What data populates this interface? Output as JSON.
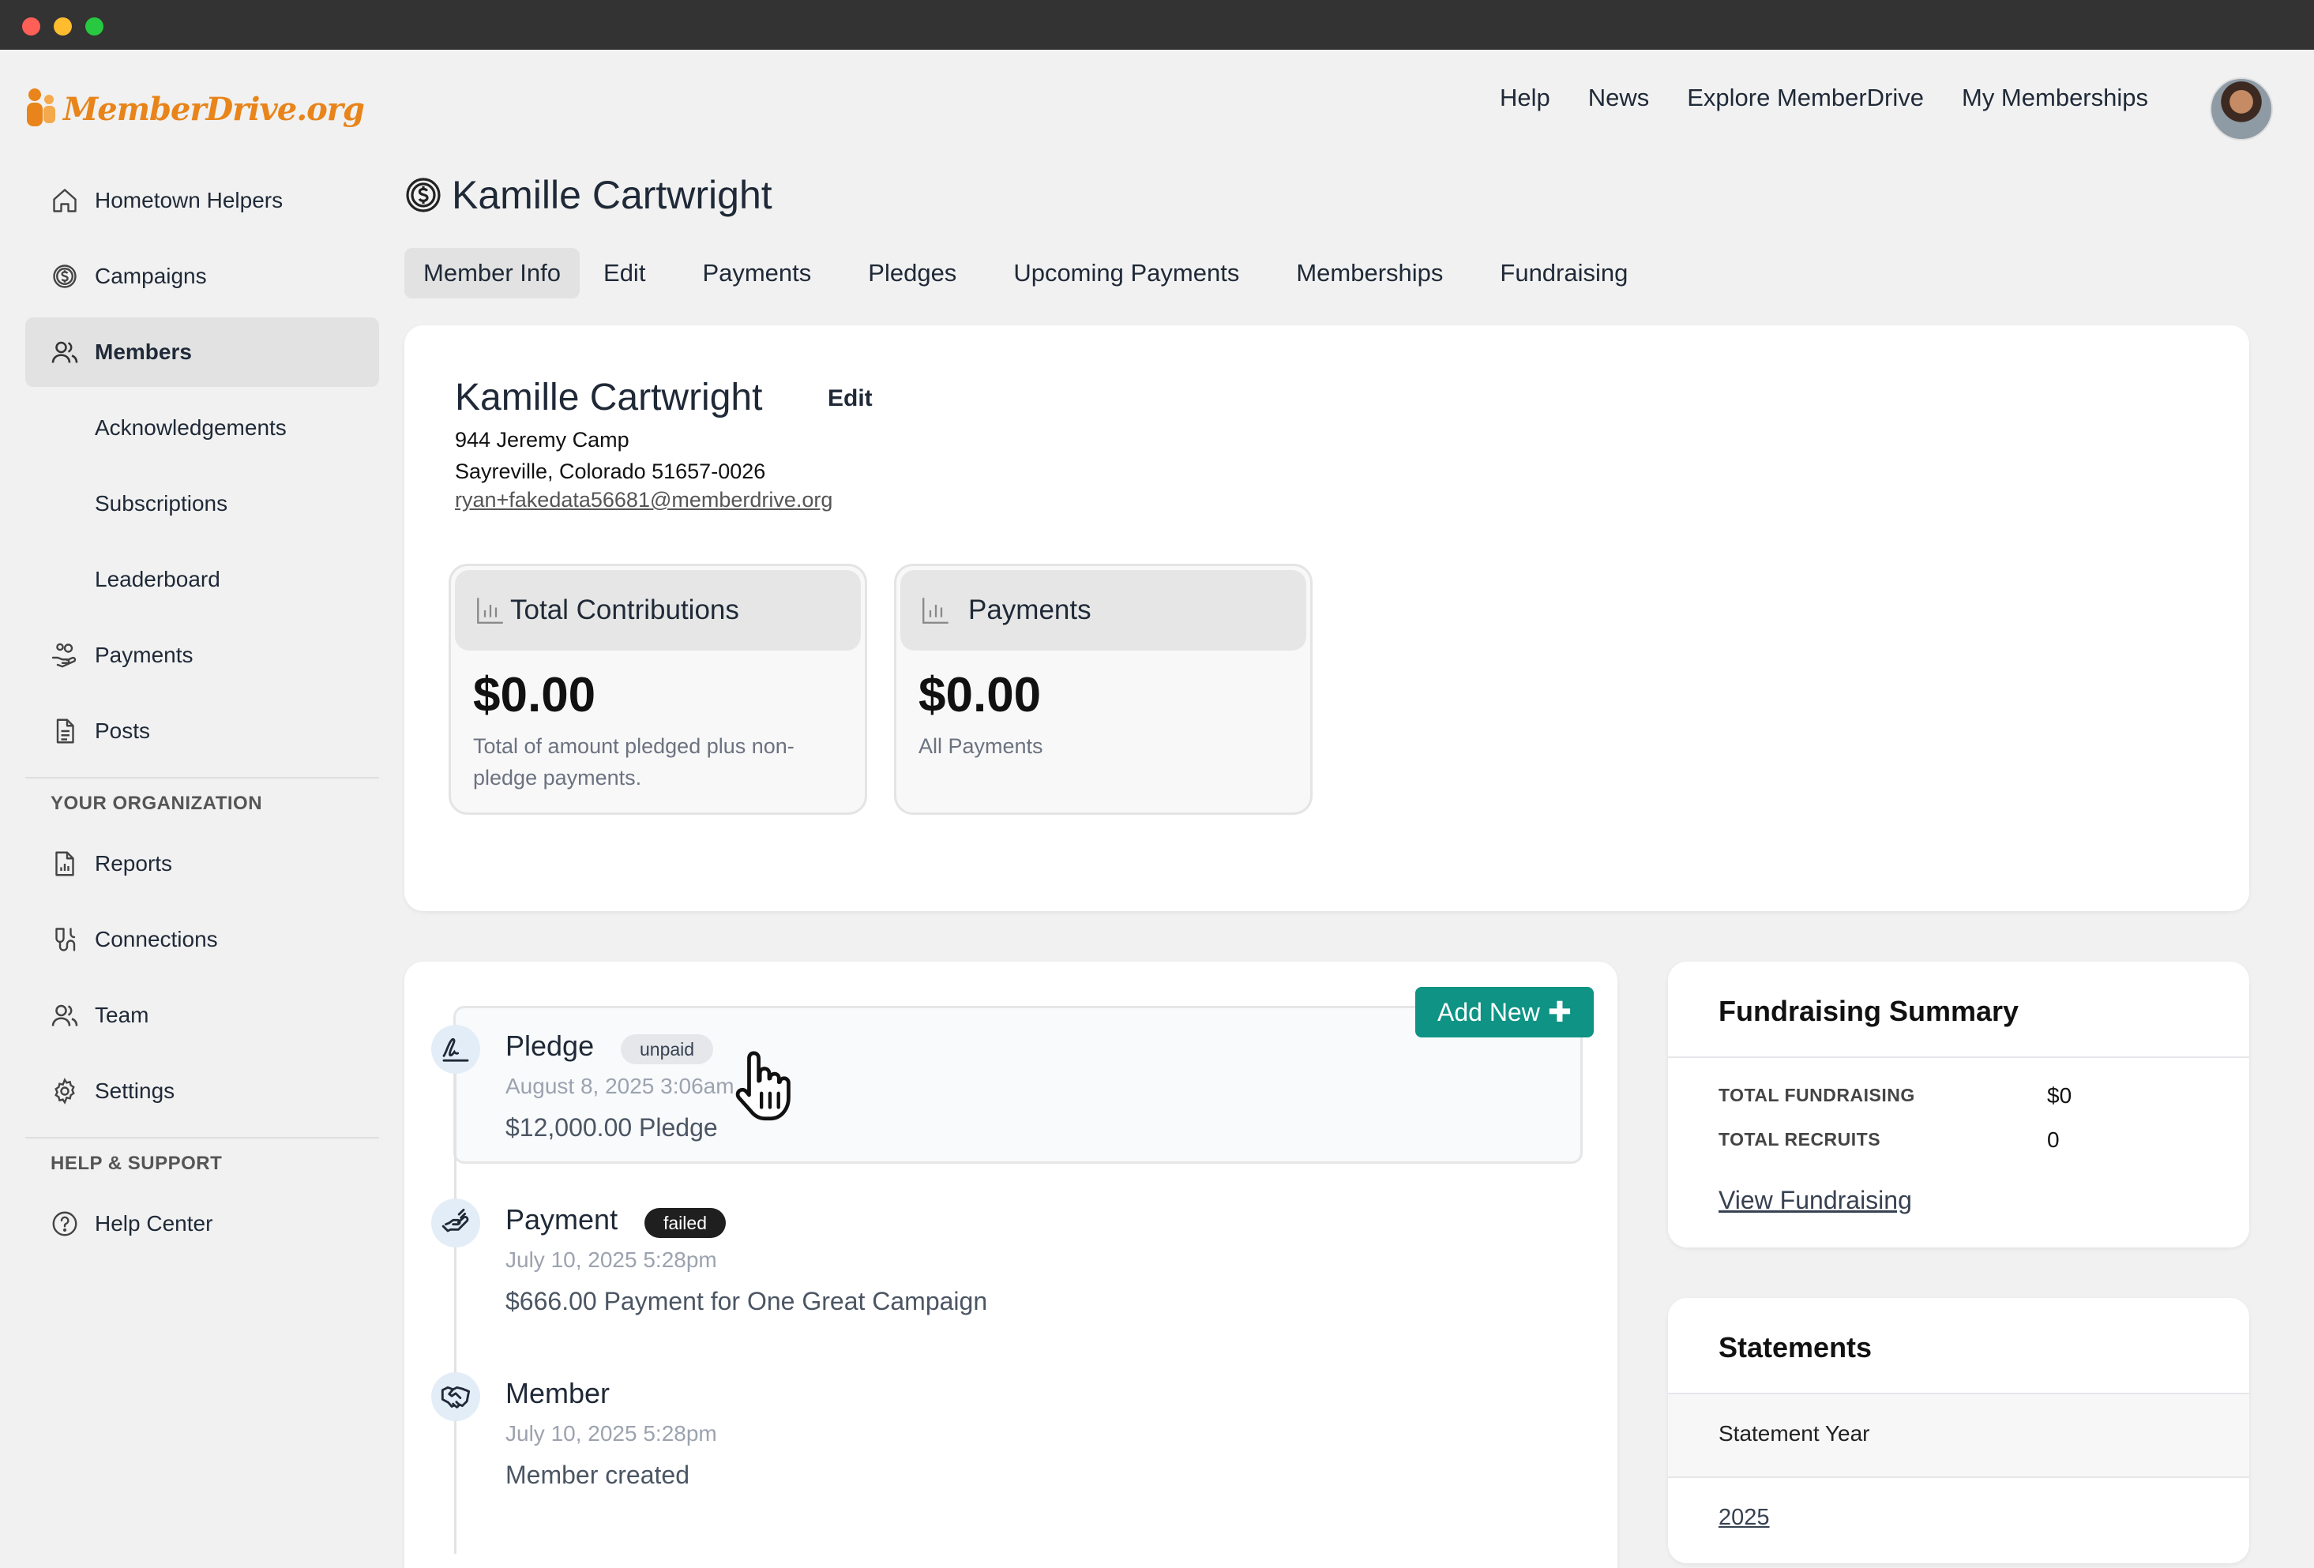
{
  "logo": {
    "text": "MemberDrive.org"
  },
  "topnav": {
    "items": [
      "Help",
      "News",
      "Explore MemberDrive",
      "My Memberships"
    ]
  },
  "sidebar": {
    "items": [
      {
        "label": "Hometown Helpers",
        "icon": "home-icon"
      },
      {
        "label": "Campaigns",
        "icon": "dollar-circle-icon"
      },
      {
        "label": "Members",
        "icon": "users-icon",
        "active": true
      },
      {
        "label": "Acknowledgements"
      },
      {
        "label": "Subscriptions"
      },
      {
        "label": "Leaderboard"
      },
      {
        "label": "Payments",
        "icon": "hand-coins-icon"
      },
      {
        "label": "Posts",
        "icon": "document-icon"
      }
    ],
    "org_title": "YOUR ORGANIZATION",
    "org_items": [
      {
        "label": "Reports",
        "icon": "report-icon"
      },
      {
        "label": "Connections",
        "icon": "connections-icon"
      },
      {
        "label": "Team",
        "icon": "team-icon"
      },
      {
        "label": "Settings",
        "icon": "gear-icon"
      }
    ],
    "help_title": "HELP & SUPPORT",
    "help_items": [
      {
        "label": "Help Center",
        "icon": "question-circle-icon"
      }
    ]
  },
  "page": {
    "title": "Kamille Cartwright",
    "tabs": [
      "Member Info",
      "Edit",
      "Payments",
      "Pledges",
      "Upcoming Payments",
      "Memberships",
      "Fundraising"
    ],
    "active_tab": "Member Info"
  },
  "member": {
    "name": "Kamille Cartwright",
    "edit_label": "Edit",
    "address_line1": "944 Jeremy Camp",
    "address_line2": "Sayreville, Colorado 51657-0026",
    "email": "ryan+fakedata56681@memberdrive.org"
  },
  "stats": [
    {
      "title": "Total Contributions",
      "value": "$0.00",
      "desc": "Total of amount pledged plus non-pledge payments."
    },
    {
      "title": "Payments",
      "value": "$0.00",
      "desc": "All Payments"
    }
  ],
  "timeline": {
    "add_new_label": "Add New",
    "items": [
      {
        "title": "Pledge",
        "badge": "unpaid",
        "date": "August 8, 2025 3:06am",
        "desc": "$12,000.00 Pledge",
        "icon": "signature-icon"
      },
      {
        "title": "Payment",
        "badge": "failed",
        "date": "July 10, 2025 5:28pm",
        "desc": "$666.00 Payment for One Great Campaign",
        "icon": "hand-payment-icon"
      },
      {
        "title": "Member",
        "badge": "",
        "date": "July 10, 2025 5:28pm",
        "desc": "Member created",
        "icon": "handshake-icon"
      }
    ]
  },
  "fundraising": {
    "title": "Fundraising Summary",
    "rows": [
      {
        "label": "TOTAL FUNDRAISING",
        "value": "$0"
      },
      {
        "label": "TOTAL RECRUITS",
        "value": "0"
      }
    ],
    "link": "View Fundraising"
  },
  "statements": {
    "title": "Statements",
    "column": "Statement Year",
    "years": [
      "2025"
    ]
  },
  "colors": {
    "accent": "#0e9384",
    "brand": "#e8841a"
  }
}
